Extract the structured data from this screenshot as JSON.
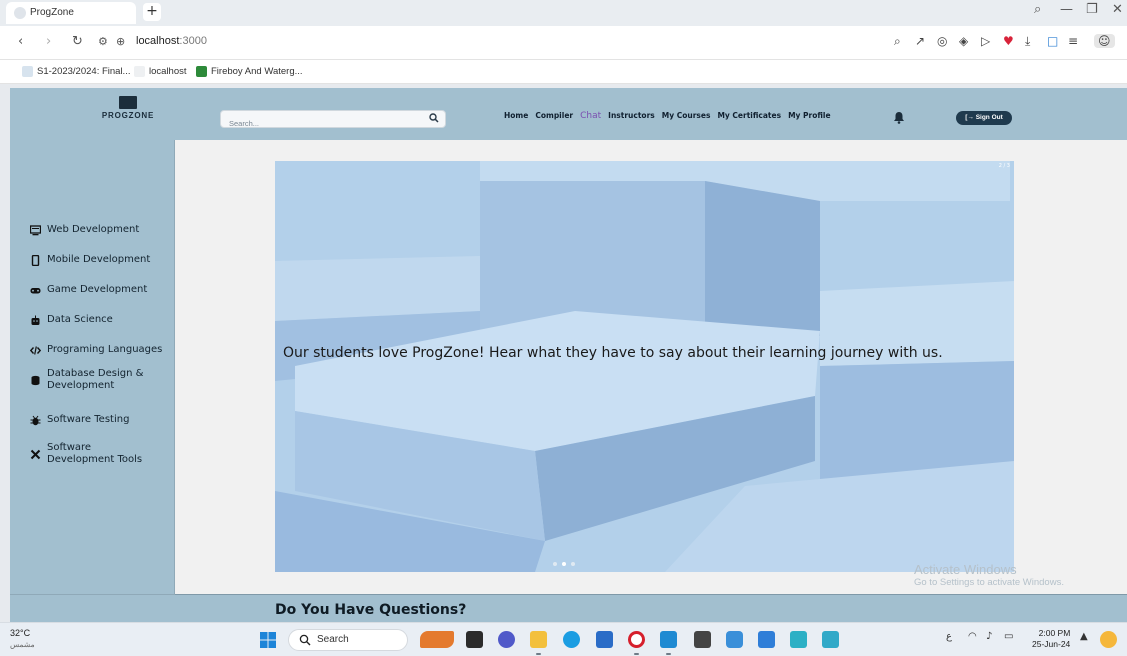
{
  "browser": {
    "tab_title": "ProgZone",
    "new_tab": "+",
    "url_host": "localhost",
    "url_port": ":3000",
    "bookmarks": [
      {
        "label": "S1-2023/2024: Final..."
      },
      {
        "label": "localhost"
      },
      {
        "label": "Fireboy And Waterg..."
      }
    ]
  },
  "site": {
    "logo_text": "PROGZONE",
    "search_placeholder": "Search...",
    "nav": [
      {
        "label": "Home"
      },
      {
        "label": "Compiler"
      },
      {
        "label": "Chat"
      },
      {
        "label": "Instructors"
      },
      {
        "label": "My Courses"
      },
      {
        "label": "My Certificates"
      },
      {
        "label": "My Profile"
      }
    ],
    "active_nav": "Chat",
    "sign_out": "[→ Sign Out",
    "sidebar": [
      {
        "label": "Web Development",
        "icon": "monitor-icon"
      },
      {
        "label": "Mobile Development",
        "icon": "mobile-icon"
      },
      {
        "label": "Game Development",
        "icon": "gamepad-icon"
      },
      {
        "label": "Data Science",
        "icon": "robot-icon"
      },
      {
        "label": "Programing Languages",
        "icon": "code-icon"
      },
      {
        "label": "Database Design & Development",
        "icon": "database-icon"
      },
      {
        "label": "Software Testing",
        "icon": "bug-icon"
      },
      {
        "label": "Software Development Tools",
        "icon": "tools-icon"
      }
    ],
    "carousel": {
      "caption": "Our students love ProgZone! Hear what they have to say about their learning journey with us.",
      "slide_count": "2 / 3",
      "active_slide": 2,
      "total_slides": 3
    },
    "questions_heading": "Do You Have Questions?"
  },
  "watermark": {
    "line1": "Activate Windows",
    "line2": "Go to Settings to activate Windows."
  },
  "taskbar": {
    "temperature": "32°C",
    "weather_text": "مشمس",
    "search_label": "Search",
    "lang": "ع",
    "time": "2:00 PM",
    "date": "25-Jun-24"
  },
  "colors": {
    "header_bg": "#a2bfcf",
    "active_nav": "#7b4fb0",
    "sign_out_bg": "#1f3a4e",
    "carousel_bg": "#a8c7e3"
  }
}
